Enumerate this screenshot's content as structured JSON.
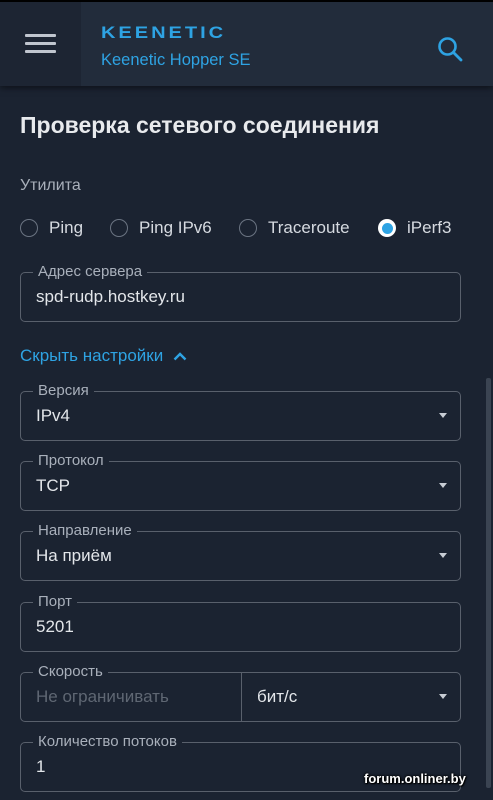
{
  "header": {
    "brand": "KEENETIC",
    "model": "Keenetic Hopper SE",
    "menu_icon": "hamburger-icon",
    "search_icon": "search-icon"
  },
  "page": {
    "title": "Проверка сетевого соединения",
    "utility_label": "Утилита",
    "utilities": [
      {
        "label": "Ping",
        "selected": false
      },
      {
        "label": "Ping IPv6",
        "selected": false
      },
      {
        "label": "Traceroute",
        "selected": false
      },
      {
        "label": "iPerf3",
        "selected": true
      }
    ],
    "server": {
      "label": "Адрес сервера",
      "value": "spd-rudp.hostkey.ru"
    },
    "toggle_settings": "Скрыть настройки",
    "version": {
      "label": "Версия",
      "value": "IPv4"
    },
    "protocol": {
      "label": "Протокол",
      "value": "TCP"
    },
    "direction": {
      "label": "Направление",
      "value": "На приём"
    },
    "port": {
      "label": "Порт",
      "value": "5201"
    },
    "speed": {
      "label": "Скорость",
      "placeholder": "Не ограничивать",
      "unit": "бит/с"
    },
    "streams": {
      "label": "Количество потоков",
      "value": "1"
    }
  },
  "watermark": "forum.onliner.by",
  "colors": {
    "accent": "#2ea3e3",
    "background": "#1b2331",
    "header": "#222c3b"
  }
}
